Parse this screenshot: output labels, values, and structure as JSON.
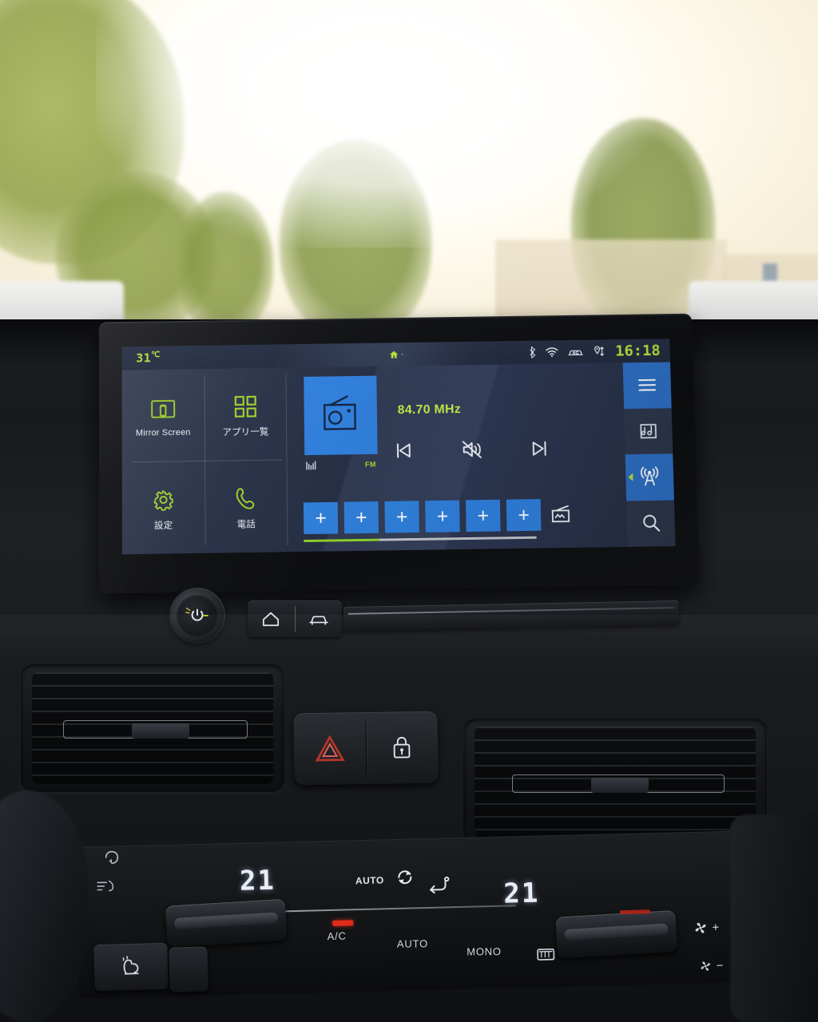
{
  "head_unit": {
    "status_bar": {
      "temperature": "31",
      "temperature_unit": "℃",
      "home_icon": "home-icon",
      "bluetooth_icon": "bluetooth-icon",
      "wifi_icon": "wifi-icon",
      "network_icon": "4g-car-icon",
      "network_label": "4G",
      "location_icon": "location-arrows-icon",
      "clock": "16:18"
    },
    "tiles": [
      {
        "label": "Mirror Screen",
        "icon": "mirror-screen-icon"
      },
      {
        "label": "アプリ一覧",
        "icon": "apps-grid-icon"
      },
      {
        "label": "設定",
        "icon": "gear-icon"
      },
      {
        "label": "電話",
        "icon": "phone-handset-icon"
      }
    ],
    "media": {
      "source_icon": "radio-icon",
      "frequency": "84.70 MHz",
      "band": "FM",
      "signal_icon": "signal-bars-icon",
      "transport": [
        {
          "name": "previous-track-button",
          "icon": "skip-previous-icon"
        },
        {
          "name": "mute-button",
          "icon": "volume-mute-icon"
        },
        {
          "name": "next-track-button",
          "icon": "skip-next-icon"
        }
      ],
      "presets": [
        {
          "label": "+"
        },
        {
          "label": "+"
        },
        {
          "label": "+"
        },
        {
          "label": "+"
        },
        {
          "label": "+"
        },
        {
          "label": "+"
        }
      ],
      "preset_list_icon": "radio-presets-list-icon",
      "scroll_progress": 32
    },
    "rail": [
      {
        "name": "menu-button",
        "icon": "hamburger-menu-icon",
        "active": true
      },
      {
        "name": "media-button",
        "icon": "music-folder-icon",
        "active": false
      },
      {
        "name": "radio-button",
        "icon": "radio-tower-icon",
        "active": true
      },
      {
        "name": "search-button",
        "icon": "search-icon",
        "active": false
      }
    ],
    "colors": {
      "accent_green": "#b9e03c",
      "tile_blue": "#2f7fdc",
      "screen_bg": "#232c42"
    }
  },
  "console": {
    "power_knob_icon": "power-volume-knob-icon",
    "home_button_icon": "home-icon",
    "vehicle_button_icon": "car-icon",
    "hazard_button_icon": "hazard-triangle-icon",
    "lock_button_icon": "door-lock-icon",
    "vent_left_icon": "air-vent-icon",
    "vent_right_icon": "air-vent-icon"
  },
  "climate": {
    "temp_left": "21",
    "temp_right": "21",
    "auto_indicator": "AUTO",
    "recirculate_icon": "recirculate-icon",
    "airflow_icon": "airflow-seat-icon",
    "buttons": [
      {
        "label": "",
        "icon": "front-defrost-icon",
        "name": "front-defrost-button"
      },
      {
        "label": "A/C",
        "icon": "",
        "name": "ac-button",
        "led": true
      },
      {
        "label": "AUTO",
        "icon": "",
        "name": "auto-button"
      },
      {
        "label": "MONO",
        "icon": "",
        "name": "mono-button"
      },
      {
        "label": "",
        "icon": "rear-defrost-icon",
        "name": "rear-defrost-button"
      }
    ],
    "fan_up_label": "+",
    "fan_down_label": "−",
    "fan_icon": "fan-icon",
    "seat_heater_icon": "seat-heater-icon",
    "recirc_icon_a": "air-recirculation-icon",
    "recirc_icon_b": "air-external-icon"
  }
}
